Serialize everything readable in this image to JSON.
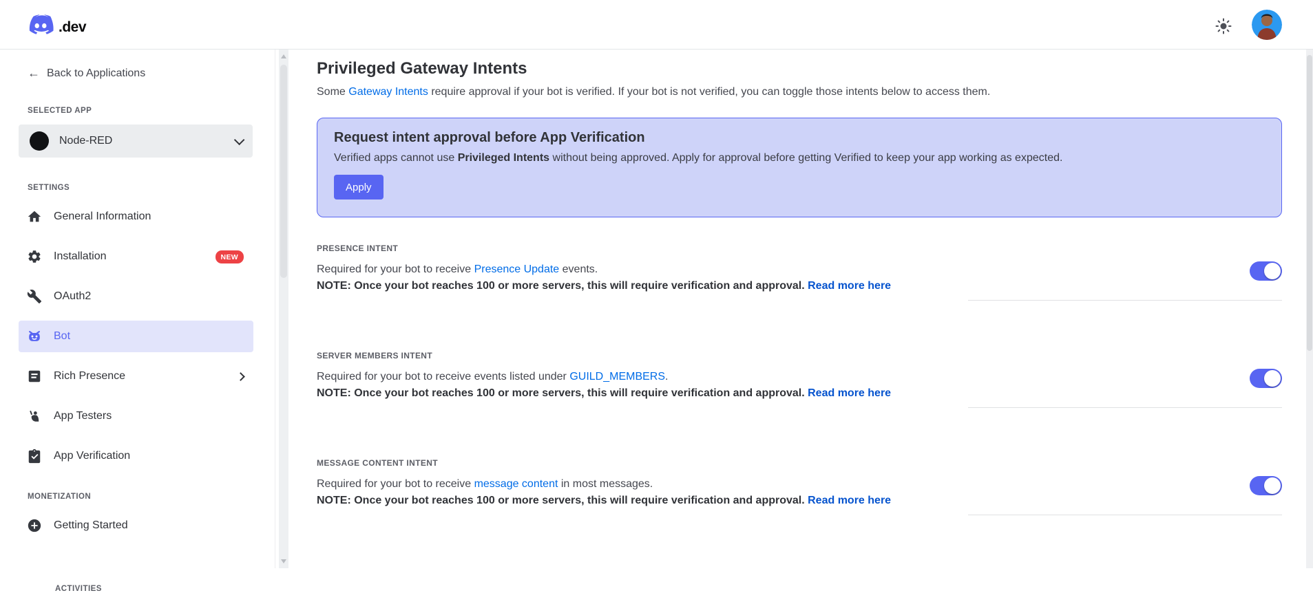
{
  "header": {
    "logo_suffix": ".dev"
  },
  "sidebar": {
    "back_label": "Back to Applications",
    "selected_app_label": "SELECTED APP",
    "app_name": "Node-RED",
    "settings_label": "SETTINGS",
    "items": [
      {
        "label": "General Information"
      },
      {
        "label": "Installation",
        "badge": "NEW"
      },
      {
        "label": "OAuth2"
      },
      {
        "label": "Bot",
        "active": true
      },
      {
        "label": "Rich Presence",
        "chevron": true
      },
      {
        "label": "App Testers"
      },
      {
        "label": "App Verification"
      }
    ],
    "monetization_label": "MONETIZATION",
    "monetization_items": [
      {
        "label": "Getting Started"
      }
    ],
    "activities_label": "ACTIVITIES"
  },
  "main": {
    "title": "Privileged Gateway Intents",
    "intro": {
      "pre": "Some ",
      "link": "Gateway Intents",
      "post": " require approval if your bot is verified. If your bot is not verified, you can toggle those intents below to access them."
    },
    "banner": {
      "title": "Request intent approval before App Verification",
      "body_pre": "Verified apps cannot use ",
      "body_bold": "Privileged Intents",
      "body_post": " without being approved. Apply for approval before getting Verified to keep your app working as expected.",
      "button_label": "Apply"
    },
    "intents": [
      {
        "label": "PRESENCE INTENT",
        "pre": "Required for your bot to receive ",
        "link": "Presence Update",
        "post": " events.",
        "note": "NOTE: Once your bot reaches 100 or more servers, this will require verification and approval. ",
        "note_link": "Read more here",
        "enabled": true
      },
      {
        "label": "SERVER MEMBERS INTENT",
        "pre": "Required for your bot to receive events listed under ",
        "link": "GUILD_MEMBERS",
        "post": ".",
        "note": "NOTE: Once your bot reaches 100 or more servers, this will require verification and approval. ",
        "note_link": "Read more here",
        "enabled": true
      },
      {
        "label": "MESSAGE CONTENT INTENT",
        "pre": "Required for your bot to receive ",
        "link": "message content",
        "post": " in most messages.",
        "note": "NOTE: Once your bot reaches 100 or more servers, this will require verification and approval. ",
        "note_link": "Read more here",
        "enabled": true
      }
    ]
  },
  "colors": {
    "accent": "#5865f2",
    "link": "#006ce7",
    "note_link": "#0553ce",
    "banner_bg": "#ced3f9",
    "active_nav_bg": "#e2e4fb",
    "badge_red": "#ed4245",
    "toggle_on": "#5865f2"
  }
}
